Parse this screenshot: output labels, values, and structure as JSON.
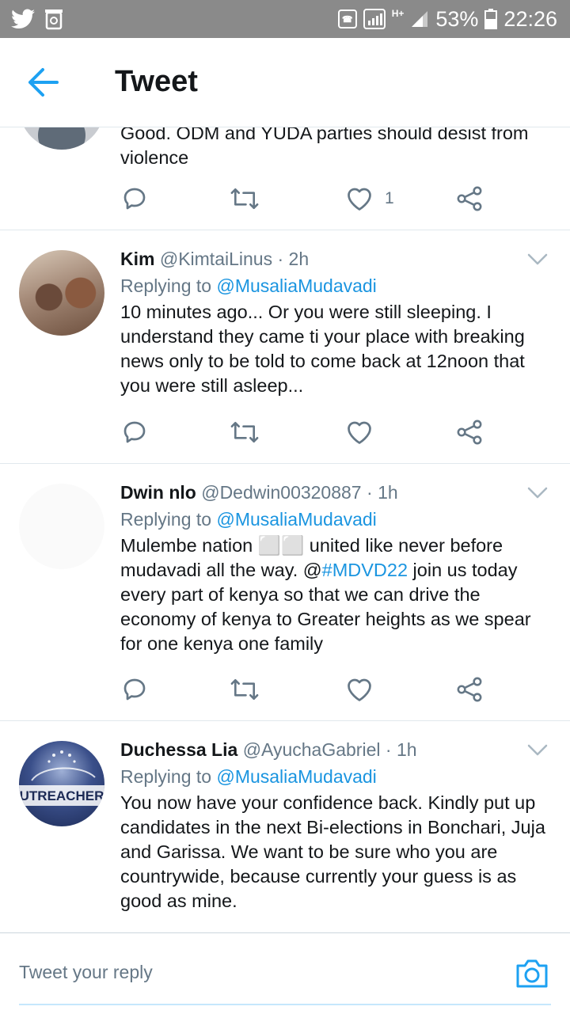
{
  "status_bar": {
    "battery": "53%",
    "time": "22:26",
    "network": "H+"
  },
  "header": {
    "title": "Tweet"
  },
  "colors": {
    "accent": "#1da1f2",
    "link": "#1b95e0",
    "secondary_text": "#657786",
    "divider": "#e1e8ed"
  },
  "top_tweet": {
    "text": "Good. ODM and YUDA parties should desist from violence",
    "like_count": "1"
  },
  "tweets": [
    {
      "name": "Kim",
      "handle": "@KimtaiLinus",
      "time": "2h",
      "replying_prefix": "Replying to",
      "replying_to": "@MusaliaMudavadi",
      "text": "10 minutes ago... Or you were still sleeping. I understand they came ti your place with breaking news only to be told to come back at 12noon that you were still asleep..."
    },
    {
      "name": "Dwin nlo",
      "handle": "@Dedwin00320887",
      "time": "1h",
      "replying_prefix": "Replying to",
      "replying_to": "@MusaliaMudavadi",
      "text_before": "Mulembe nation ⬜⬜ united like never before mudavadi all the way. @",
      "hashtag": "#MDVD22",
      "text_after": " join us today every part of kenya so that we can drive the economy of kenya to Greater heights  as we spear for one kenya one family"
    },
    {
      "name": "Duchessa Lia",
      "handle": "@AyuchaGabriel",
      "time": "1h",
      "replying_prefix": "Replying to",
      "replying_to": "@MusaliaMudavadi",
      "avatar_text": "UTREACHER",
      "text": "You now have your confidence back. Kindly put up candidates in the next Bi-elections in Bonchari, Juja and Garissa. We want to be sure who you are countrywide, because currently your guess is as good as mine."
    }
  ],
  "reply_bar": {
    "placeholder": "Tweet your reply"
  },
  "separator": "·"
}
